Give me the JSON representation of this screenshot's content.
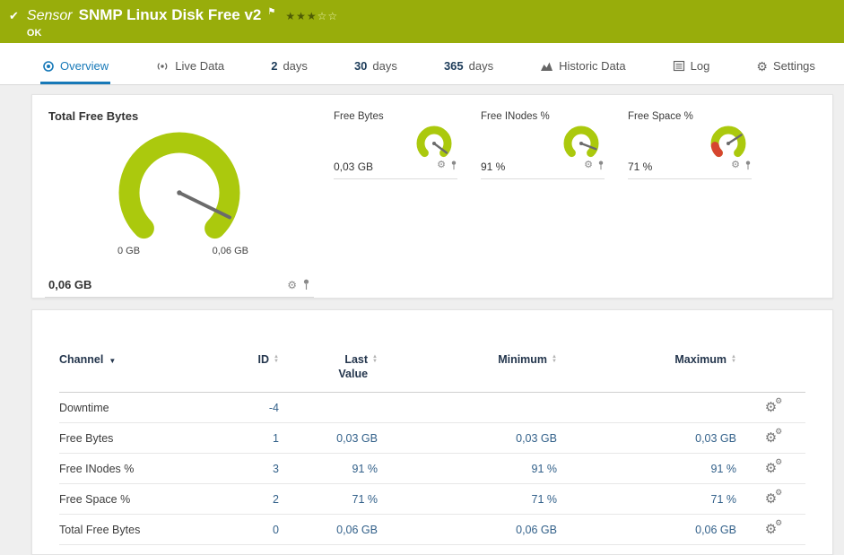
{
  "colors": {
    "gauge_green": "#abc90d",
    "red": "#d6452f",
    "needle": "#6b6b6b",
    "accent_blue": "#1779b8"
  },
  "icons": {
    "gear": "⚙",
    "sort_up": "▲",
    "sort_down": "▼",
    "sorted": "▼"
  },
  "header": {
    "check_icon": "✔",
    "type_label": "Sensor",
    "title": "SNMP Linux Disk Free v2",
    "flag_icon": "⚑",
    "stars_filled": "★★★",
    "stars_empty": "☆☆",
    "status": "OK"
  },
  "tabs": {
    "overview": {
      "label": "Overview"
    },
    "live": {
      "label": "Live Data"
    },
    "d2": {
      "num": "2",
      "label": "days"
    },
    "d30": {
      "num": "30",
      "label": "days"
    },
    "d365": {
      "num": "365",
      "label": "days"
    },
    "historic": {
      "label": "Historic Data"
    },
    "log": {
      "label": "Log"
    },
    "settings": {
      "label": "Settings"
    }
  },
  "gauges": {
    "main": {
      "title": "Total Free Bytes",
      "value": "0,06 GB",
      "min_label": "0 GB",
      "max_label": "0,06 GB",
      "percent": 93
    },
    "small": [
      {
        "title": "Free Bytes",
        "value": "0,03 GB",
        "percent": 97
      },
      {
        "title": "Free INodes %",
        "value": "91 %",
        "percent": 91
      },
      {
        "title": "Free Space %",
        "value": "71 %",
        "percent": 71,
        "red_zone_end_percent": 13
      }
    ]
  },
  "table": {
    "headers": {
      "channel": "Channel",
      "id": "ID",
      "last_value": "Last Value",
      "minimum": "Minimum",
      "maximum": "Maximum"
    },
    "rows": [
      {
        "channel": "Downtime",
        "id": "-4",
        "last": "",
        "min": "",
        "max": ""
      },
      {
        "channel": "Free Bytes",
        "id": "1",
        "last": "0,03 GB",
        "min": "0,03 GB",
        "max": "0,03 GB"
      },
      {
        "channel": "Free INodes %",
        "id": "3",
        "last": "91 %",
        "min": "91 %",
        "max": "91 %"
      },
      {
        "channel": "Free Space %",
        "id": "2",
        "last": "71 %",
        "min": "71 %",
        "max": "71 %"
      },
      {
        "channel": "Total Free Bytes",
        "id": "0",
        "last": "0,06 GB",
        "min": "0,06 GB",
        "max": "0,06 GB"
      }
    ]
  }
}
